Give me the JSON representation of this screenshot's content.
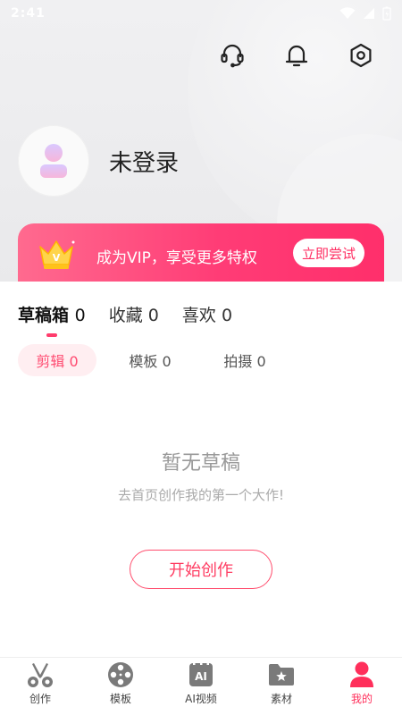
{
  "status_bar": {
    "time": "2:41"
  },
  "header": {
    "icons": [
      "headset-icon",
      "bell-icon",
      "settings-icon"
    ]
  },
  "profile": {
    "username": "未登录"
  },
  "vip_banner": {
    "text": "成为VIP，享受更多特权",
    "button": "立即尝试",
    "badge_letter": "V"
  },
  "tabs": [
    {
      "label": "草稿箱",
      "count": "0",
      "active": true
    },
    {
      "label": "收藏",
      "count": "0",
      "active": false
    },
    {
      "label": "喜欢",
      "count": "0",
      "active": false
    }
  ],
  "subtabs": [
    {
      "label": "剪辑 0",
      "active": true
    },
    {
      "label": "模板 0",
      "active": false
    },
    {
      "label": "拍摄 0",
      "active": false
    }
  ],
  "empty_state": {
    "title": "暂无草稿",
    "subtitle": "去首页创作我的第一个大作!",
    "button": "开始创作"
  },
  "bottom_nav": [
    {
      "label": "创作",
      "icon": "scissors-icon",
      "active": false
    },
    {
      "label": "模板",
      "icon": "film-reel-icon",
      "active": false
    },
    {
      "label": "AI视频",
      "icon": "ai-video-icon",
      "active": false,
      "icon_text": "AI"
    },
    {
      "label": "素材",
      "icon": "folder-star-icon",
      "active": false
    },
    {
      "label": "我的",
      "icon": "person-icon",
      "active": true
    }
  ],
  "colors": {
    "accent": "#ff2f5b",
    "vip_start": "#ff6a8f",
    "vip_end": "#ff2f6b",
    "inactive_icon": "#7a7a7a"
  }
}
